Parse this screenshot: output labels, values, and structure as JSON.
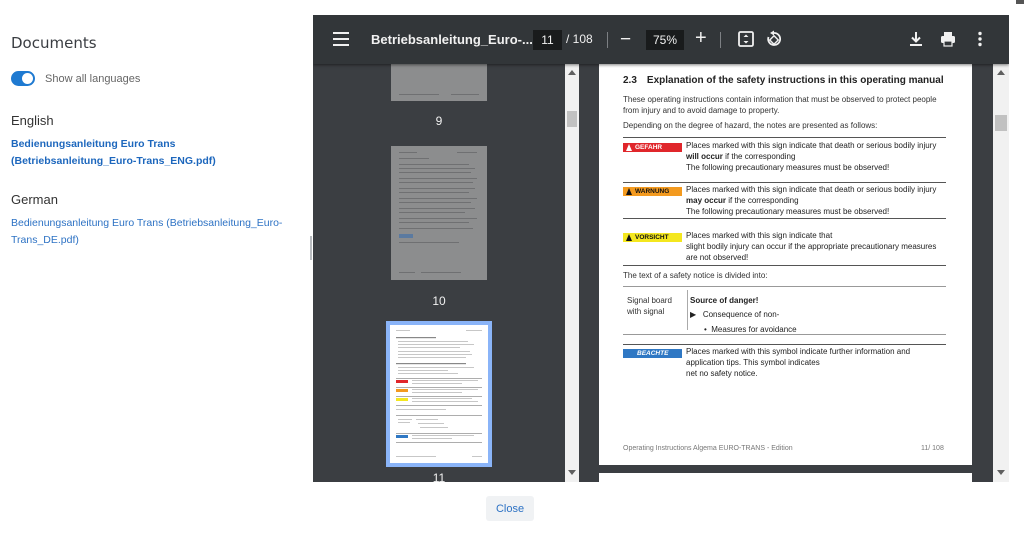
{
  "documents_panel": {
    "title": "Documents",
    "toggle_label": "Show all languages",
    "toggle_on": true,
    "languages": [
      {
        "name": "English",
        "link": "Bedienungsanleitung Euro Trans (Betriebsanleitung_Euro-Trans_ENG.pdf)",
        "active": true
      },
      {
        "name": "German",
        "link": "Bedienungsanleitung Euro Trans (Betriebsanleitung_Euro-Trans_DE.pdf)",
        "active": false
      }
    ]
  },
  "viewer": {
    "file_title": "Betriebsanleitung_Euro-...",
    "current_page": "11",
    "page_total": "/ 108",
    "zoom": "75%",
    "zoom_minus": "−",
    "zoom_plus": "+",
    "icons": [
      "menu-icon",
      "fit-page-icon",
      "rotate-icon",
      "download-icon",
      "print-icon",
      "more-vert-icon"
    ],
    "thumbnails": [
      {
        "label": "9"
      },
      {
        "label": "10"
      },
      {
        "label": "11",
        "selected": true
      }
    ],
    "page": {
      "section_number": "2.3",
      "section_title": "Explanation of the safety instructions in this operating manual",
      "intro_1": "These operating instructions contain information that must be observed to protect people from injury and to avoid damage to property.",
      "intro_2": "Depending on the degree of hazard, the notes are presented as follows:",
      "notes": [
        {
          "badge": "GEFAHR",
          "color": "#e0262b",
          "lines": [
            "Places marked with this sign indicate that death or serious bodily injury",
            "will occur",
            " if the corresponding",
            "The following precautionary measures must be observed!"
          ]
        },
        {
          "badge": "WARNUNG",
          "color": "#f39a1f",
          "lines": [
            "Places marked with this sign indicate that death or serious bodily injury",
            "may occur",
            " if the corresponding",
            "The following precautionary measures must be observed!"
          ]
        },
        {
          "badge": "VORSICHT",
          "color": "#f4e71f",
          "lines": [
            "Places marked with this sign indicate that",
            "slight bodily injury can occur if the appropriate precautionary measures",
            "are not observed!"
          ]
        }
      ],
      "structure_intro": "The text of a safety notice is divided into:",
      "signal_label_1": "Signal board",
      "signal_label_2": "with signal",
      "source_of_danger": "Source of danger!",
      "consequence": "Consequence of non-",
      "measures": "Measures for avoidance",
      "beachte_badge": "BEACHTE",
      "beachte_color": "#2f78c4",
      "beachte_lines": [
        "Places marked with this symbol indicate further information and",
        "application tips. This symbol indicates",
        "net no safety notice."
      ],
      "footer_left": "Operating Instructions Algema EURO-TRANS - Edition",
      "footer_right": "11/ 108"
    }
  },
  "close_button": "Close"
}
